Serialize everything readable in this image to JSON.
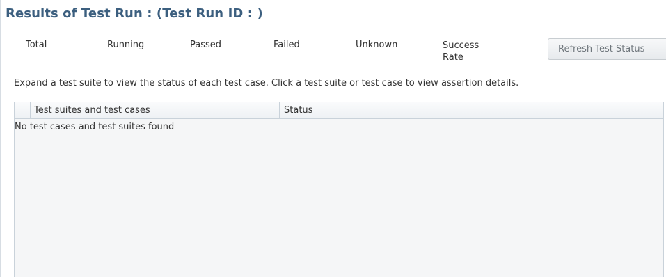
{
  "title": "Results of Test Run : (Test Run ID : )",
  "summary": {
    "total_label": "Total",
    "running_label": "Running",
    "passed_label": "Passed",
    "failed_label": "Failed",
    "unknown_label": "Unknown",
    "success_rate_label": "Success Rate"
  },
  "refresh_button_label": "Refresh Test Status",
  "instructions": "Expand a test suite to view the status of each test case. Click a test suite or test case to view assertion details.",
  "table": {
    "columns": [
      "Test suites and test cases",
      "Status"
    ],
    "empty_message": "No test cases and test suites found"
  },
  "colors": {
    "title": "#3c5f7f",
    "text": "#333333",
    "button_text": "#6f767c",
    "border": "#c9d2da",
    "table_background": "#f5f6f7"
  }
}
